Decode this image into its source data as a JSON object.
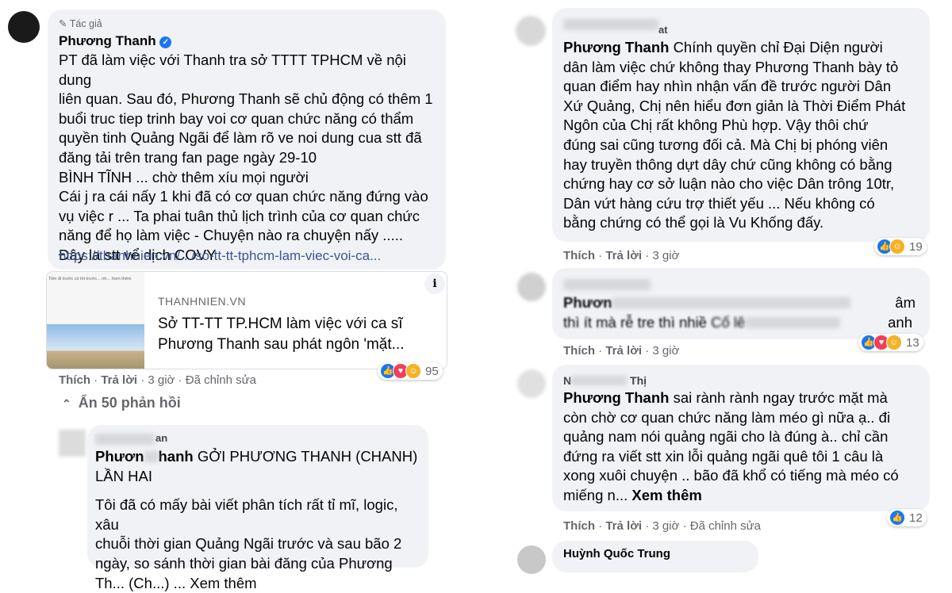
{
  "left": {
    "author_badge": "Tác giả",
    "post": {
      "author": "Phương Thanh",
      "lines": [
        "PT đã làm việc với Thanh tra sở TTTT TPHCM về nội dung",
        "liên quan. Sau đó, Phương Thanh sẽ chủ động có thêm 1",
        "buổi truc tiep trinh bay voi cơ quan chức năng có thẩm",
        "quyền tinh Quảng Ngãi để làm rõ ve noi dung cua stt đã",
        "đăng tải trên trang fan page ngày 29-10",
        "BÌNH TĨNH ... chờ thêm xíu mọi người",
        "Cái j ra cái nấy 1 khi đã có cơ quan chức năng đứng vào",
        "vụ việc r ... Ta phai tuân thủ lịch trình của cơ quan chức",
        "năng để họ làm việc - Chuyện nào ra chuyện nấy .....",
        "Đây la stt vể dịch COVY"
      ],
      "link": "https://thanhnien.vn/.../so-tt-tt-tphcm-lam-viec-voi-ca..."
    },
    "preview": {
      "source": "THANHNIEN.VN",
      "title_1": "Sở TT-TT TP.HCM làm việc với ca sĩ",
      "title_2": "Phương Thanh sau phát ngôn 'mặt...",
      "info": "i",
      "thumb_caption": "Tiền đi trước có lời trước... nh... Xem thêm"
    },
    "actions": {
      "like": "Thích",
      "reply": "Trả lời",
      "time": "3 giờ",
      "edited": "Đã chỉnh sửa"
    },
    "reactions": {
      "count": "95"
    },
    "hide_replies": "Ẩn 50 phản hồi",
    "reply": {
      "name_fragment": "an",
      "name_start": "Phươn",
      "name_end": "hanh",
      "first_line": "GỞI PHƯƠNG THANH (CHANH)",
      "second_line": "LẦN HAI",
      "lines": [
        "Tôi đã có mấy bài viết phân tích rất tỉ mĩ, logic, xâu",
        "chuỗi thời gian Quảng Ngãi trước và sau bão 2",
        "ngày, so sánh thời gian bài đăng của Phương",
        "Th... (Ch...) ... Xem thêm"
      ]
    }
  },
  "right": {
    "c1": {
      "name_fragment": "at",
      "name": "Phương Thanh",
      "first_line": "Chính quyền chỉ Đại Diện người",
      "lines": [
        "dân làm việc chứ không thay Phương Thanh bày tỏ",
        "quan điểm hay nhìn nhận vấn đề trước người Dân",
        "Xứ Quảng, Chị nên hiểu đơn giản là Thời Điểm Phát",
        "Ngôn của Chị rất không Phù hợp. Vậy thôi chứ",
        "đúng sai cũng tương đối cả. Mà Chị bị phóng viên",
        "hay truyền thông dựt dây chứ cũng không có bằng",
        "chứng hay cơ sở luận nào cho việc Dân trông 10tr,",
        "Dân vứt hàng cứu trợ thiết yếu ... Nếu không có",
        "bằng chứng có thể gọi là Vu Khống đấy."
      ],
      "reactions": "19",
      "actions": {
        "like": "Thích",
        "reply": "Trả lời",
        "time": "3 giờ"
      }
    },
    "c2": {
      "name_start": "Phươn",
      "line1_end": "âm",
      "line2_start": "thì ít mà rễ tre thì nhiề",
      "line2_mid": "Cố lê",
      "line2_end": "anh",
      "reactions": "13",
      "actions": {
        "like": "Thích",
        "reply": "Trả lời",
        "time": "3 giờ"
      }
    },
    "c3": {
      "header_start": "N",
      "header_end": "Thị",
      "name": "Phương Thanh",
      "first_line": "sai rành rành ngay trước mặt mà",
      "lines": [
        "còn chờ cơ quan chức năng làm méo gì nữa ạ.. đi",
        "quảng nam nói quảng ngãi cho là đúng à.. chỉ cần",
        "đứng ra viết stt xin lỗi quảng ngãi quê tôi 1 câu là",
        "xong xuôi chuyện .. bão đã khổ có tiếng mà méo có"
      ],
      "last_line": "miếng n...",
      "see_more": "Xem thêm",
      "reactions": "12",
      "actions": {
        "like": "Thích",
        "reply": "Trả lời",
        "time": "3 giờ",
        "edited": "Đã chỉnh sửa"
      }
    },
    "c4": {
      "name": "Huỳnh Quốc Trung"
    }
  },
  "colors": {
    "bubble": "#f0f2f5",
    "link": "#385898",
    "like": "#1877f2",
    "meta": "#65676b",
    "verified": "#1877f2"
  }
}
